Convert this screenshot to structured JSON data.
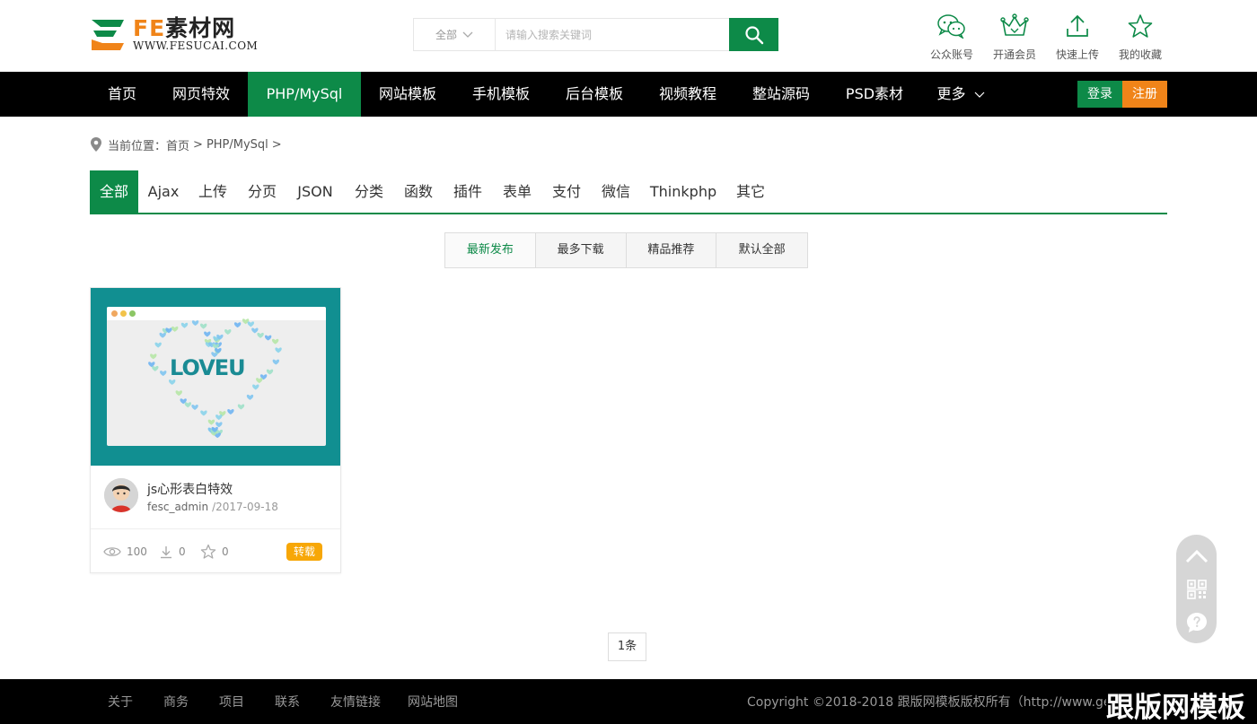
{
  "header": {
    "logo_fe": "FE",
    "logo_cn": "素材网",
    "logo_url": "WWW.FESUCAI.COM",
    "search": {
      "category": "全部",
      "placeholder": "请输入搜索关键词"
    },
    "quick_links": [
      {
        "label": "公众账号",
        "icon": "wechat-icon"
      },
      {
        "label": "开通会员",
        "icon": "crown-icon"
      },
      {
        "label": "快速上传",
        "icon": "upload-icon"
      },
      {
        "label": "我的收藏",
        "icon": "star-icon"
      }
    ]
  },
  "nav": {
    "items": [
      "首页",
      "网页特效",
      "PHP/MySql",
      "网站模板",
      "手机模板",
      "后台模板",
      "视频教程",
      "整站源码",
      "PSD素材",
      "更多"
    ],
    "active_index": 2,
    "login": "登录",
    "register": "注册"
  },
  "breadcrumb": {
    "prefix": "当前位置：",
    "items": [
      "首页",
      "PHP/MySql"
    ],
    "separator": ">"
  },
  "categories": {
    "items": [
      "全部",
      "Ajax",
      "上传",
      "分页",
      "JSON",
      "分类",
      "函数",
      "插件",
      "表单",
      "支付",
      "微信",
      "Thinkphp",
      "其它"
    ],
    "active_index": 0
  },
  "sort": {
    "items": [
      "最新发布",
      "最多下载",
      "精品推荐",
      "默认全部"
    ],
    "active_index": 0
  },
  "cards": [
    {
      "thumb_text": "LOVEU",
      "title": "js心形表白特效",
      "author": "fesc_admin",
      "date": "/2017-09-18",
      "views": "100",
      "downloads": "0",
      "favorites": "0",
      "badge": "转载"
    }
  ],
  "pagination": {
    "label": "1条"
  },
  "footer": {
    "links": [
      "关于",
      "商务",
      "项目",
      "联系",
      "友情链接",
      "网站地图"
    ],
    "copyright": "Copyright ©2018-2018 跟版网模板版权所有（http://www.gen"
  },
  "watermark": "跟版网模板",
  "colors": {
    "brand_green": "#0d8a48",
    "brand_orange": "#f08419",
    "badge_yellow": "#f7a707",
    "thumb_teal": "#118f91"
  }
}
